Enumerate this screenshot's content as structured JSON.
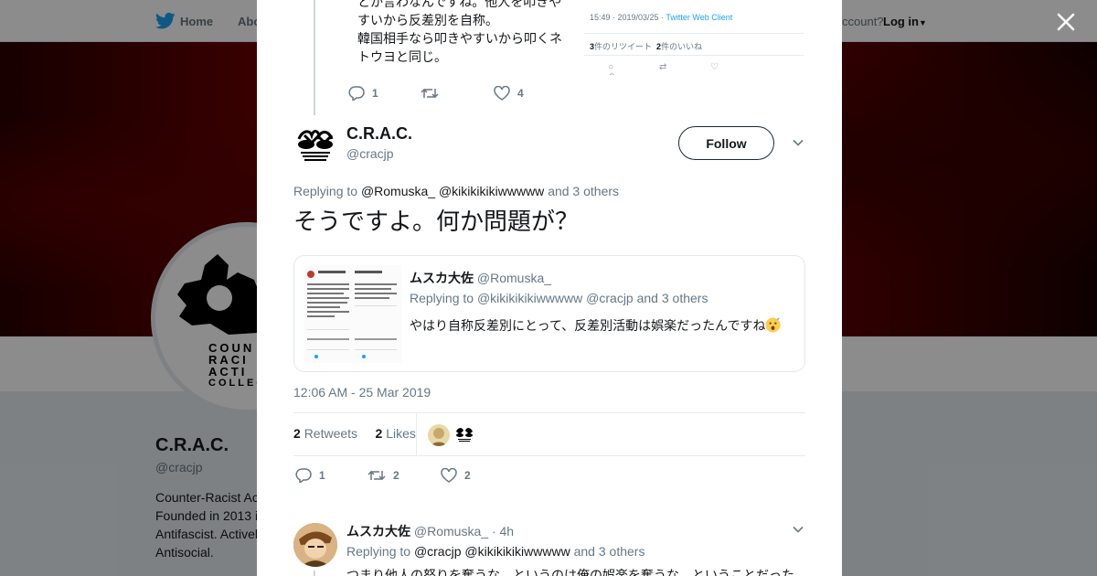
{
  "background": {
    "nav": {
      "home_label": "Home",
      "about_label": "Abo",
      "account_prompt": "ccount?",
      "login_label": "Log in"
    },
    "profile": {
      "name": "C.R.A.C.",
      "handle": "@cracjp",
      "bio": [
        "Counter-Racist Ac",
        "Founded in 2013 i",
        "Antifascist. Activel",
        "Antisocial."
      ],
      "avatar_logo_text": [
        "COUN",
        "RACI",
        "ACTI",
        "COLLEC"
      ]
    }
  },
  "previous_tweet": {
    "text_lines": [
      "とか言わなんですね。他人を叩きや",
      "すいから反差別を自称。",
      "韓国相手なら叩きやすいから叩くネ",
      "トウヨと同じ。"
    ],
    "image": {
      "meta_time": "15:49 · 2019/03/25 · ",
      "meta_client": "Twitter Web Client",
      "retweets": "3",
      "retweets_label": "件のリツイート",
      "likes": "2",
      "likes_label": "件のいいね"
    },
    "reply_count": "1",
    "like_count": "4"
  },
  "main_tweet": {
    "name": "C.R.A.C.",
    "handle": "@cracjp",
    "follow_label": "Follow",
    "replying_prefix": "Replying to",
    "replying_mention_1": "@Romuska_",
    "replying_mention_2": "@kikikikikiwwwww",
    "replying_others": "and 3 others",
    "text": "そうですよ。何か問題が？",
    "quote": {
      "name": "ムスカ大佐",
      "handle": "@Romuska_",
      "replying_prefix": "Replying to",
      "replying_mention_1": "@kikikikikiwwwww",
      "replying_mention_2": "@cracjp",
      "replying_others": "and 3 others",
      "text": "やはり自称反差別にとって、反差別活動は娯楽だったんですね"
    },
    "timestamp": "12:06 AM - 25 Mar 2019",
    "retweets_count": "2",
    "retweets_label": "Retweets",
    "likes_count": "2",
    "likes_label": "Likes",
    "reply_count": "1",
    "retweet_action_count": "2",
    "like_action_count": "2"
  },
  "next_reply": {
    "name": "ムスカ大佐",
    "handle": "@Romuska_",
    "time": "· 4h",
    "replying_prefix": "Replying to",
    "replying_mention_1": "@cracjp",
    "replying_mention_2": "@kikikikikiwwwww",
    "replying_others": "and 3 others",
    "text": "つまり他人の怒りを奪うな、というのは俺の娯楽を奪うな、ということだった"
  },
  "colors": {
    "accent": "#1da1f2",
    "muted": "#657786",
    "text": "#14171a",
    "banner": "#6a0000"
  }
}
